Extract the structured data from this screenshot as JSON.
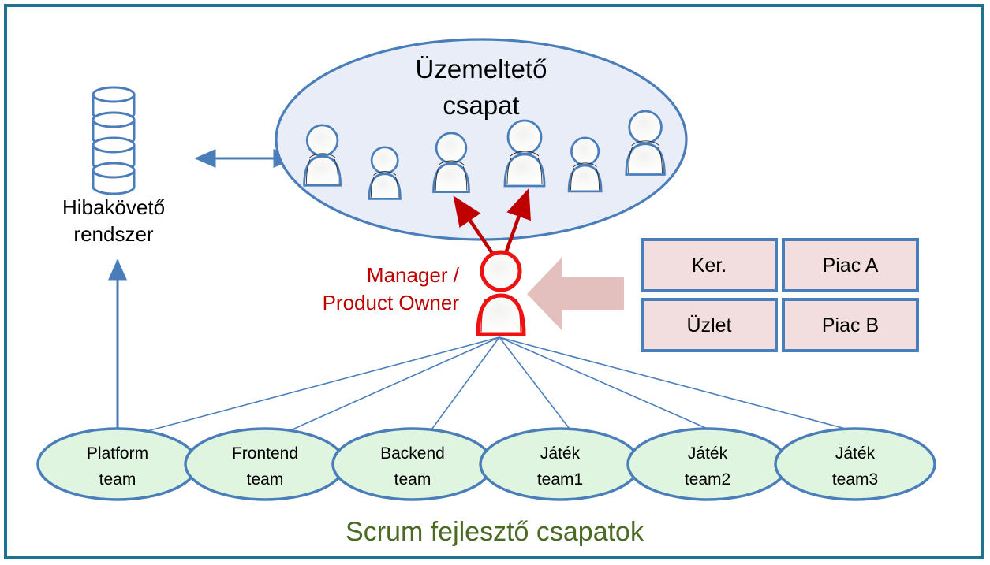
{
  "diagram": {
    "caption": "Scrum fejlesztő csapatok",
    "ops_team": {
      "title_line1": "Üzemeltető",
      "title_line2": "csapat",
      "member_count": 6,
      "fill": "#E8EDF7",
      "stroke": "#4A7EBB"
    },
    "tracker": {
      "label_line1": "Hibakövető",
      "label_line2": "rendszer",
      "icon": "database-stack-icon",
      "stroke": "#4A7EBB"
    },
    "manager": {
      "label_line1": "Manager /",
      "label_line2": "Product Owner",
      "icon": "person-icon",
      "stroke": "#EE1111",
      "text_color": "#C00000"
    },
    "stakeholders": {
      "fill": "#F2DEDE",
      "stroke": "#4A7EBB",
      "boxes": [
        {
          "label": "Ker."
        },
        {
          "label": "Piac A"
        },
        {
          "label": "Üzlet"
        },
        {
          "label": "Piac B"
        }
      ]
    },
    "teams": {
      "fill": "#DFF5DF",
      "stroke": "#4A7EBB",
      "items": [
        {
          "line1": "Platform",
          "line2": "team"
        },
        {
          "line1": "Frontend",
          "line2": "team"
        },
        {
          "line1": "Backend",
          "line2": "team"
        },
        {
          "line1": "Játék",
          "line2": "team1"
        },
        {
          "line1": "Játék",
          "line2": "team2"
        },
        {
          "line1": "Játék",
          "line2": "team3"
        }
      ]
    },
    "connectors": {
      "tracker_ops_arrow": "double-arrow-icon",
      "tracker_team_arrow": "up-arrow-icon",
      "manager_ops_arrows": "red-arrow-icon",
      "stakeholder_arrow": "left-block-arrow-icon"
    },
    "colors": {
      "frame": "#1F7391",
      "blue": "#4A7EBB",
      "red": "#EE1111",
      "dark_red": "#C00000",
      "pink": "#E3C0BD",
      "olive": "#4B6A22",
      "green_fill": "#DFF5DF",
      "blue_fill": "#E8EDF7",
      "pink_fill": "#F2DEDE"
    }
  }
}
